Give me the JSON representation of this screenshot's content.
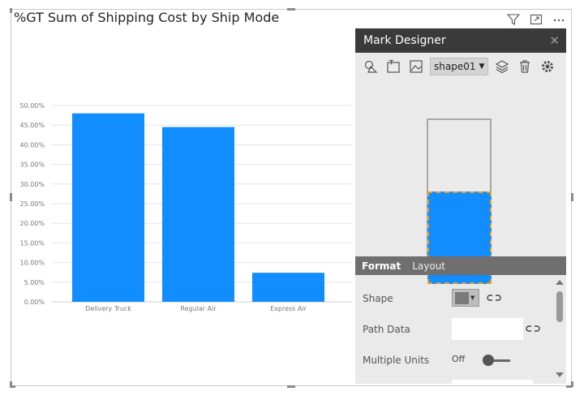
{
  "visual": {
    "title": "%GT Sum of Shipping Cost by Ship Mode",
    "header_icons": [
      "filter-icon",
      "focus-mode-icon",
      "more-options-icon"
    ]
  },
  "chart_data": {
    "type": "bar",
    "title": "%GT Sum of Shipping Cost by Ship Mode",
    "categories": [
      "Delivery Truck",
      "Regular Air",
      "Express Air"
    ],
    "values": [
      48.0,
      44.5,
      7.4
    ],
    "y_ticks": [
      "0.00%",
      "5.00%",
      "10.00%",
      "15.00%",
      "20.00%",
      "25.00%",
      "30.00%",
      "35.00%",
      "40.00%",
      "45.00%",
      "50.00%"
    ],
    "ylim": [
      0,
      50
    ],
    "grid": true,
    "bar_color": "#118dff"
  },
  "panel": {
    "title": "Mark Designer",
    "close_icon": "close-icon",
    "toolbar": {
      "icons": [
        "add-shape-icon",
        "add-text-icon",
        "add-image-icon",
        "layers-icon",
        "delete-icon",
        "settings-icon"
      ],
      "selected_shape": "shape01"
    },
    "tabs": [
      {
        "label": "Format",
        "active": true
      },
      {
        "label": "Layout",
        "active": false
      }
    ],
    "properties": {
      "shape_label": "Shape",
      "path_data_label": "Path Data",
      "path_data_value": "",
      "multiple_units_label": "Multiple Units",
      "multiple_units_state": "Off"
    },
    "colors": {
      "header_bg": "#3a3a3a",
      "panel_bg": "#eaeaea",
      "fill": "#118dff",
      "selection": "#e6a020"
    }
  }
}
